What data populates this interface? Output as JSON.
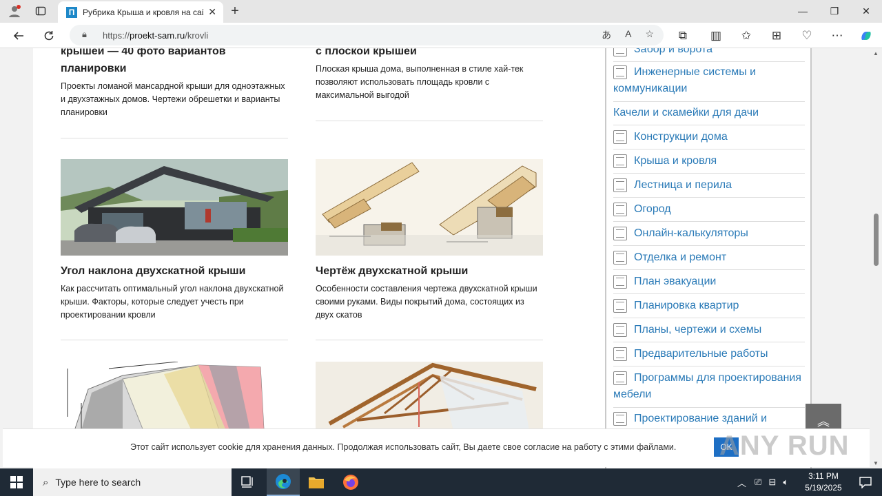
{
  "browser": {
    "tab_title": "Рубрика Крыша и кровля на сайте",
    "tab_favicon": "П",
    "url_prefix": "https://",
    "url_host": "proekt-sam.ru",
    "url_path": "/krovli"
  },
  "articles": [
    {
      "title": "крышей — 40 фото вариантов планировки",
      "desc": "Проекты ломаной мансардной крыши для одноэтажных и двухэтажных домов. Чертежи обрешетки и варианты планировки"
    },
    {
      "title": "с плоской крышей",
      "desc": "Плоская крыша дома, выполненная в стиле хай-тек позволяют использовать площадь кровли с максимальной выгодой"
    },
    {
      "title": "Угол наклона двухскатной крыши",
      "desc": "Как рассчитать оптимальный угол наклона двухскатной крыши. Факторы, которые следует учесть при проектировании кровли"
    },
    {
      "title": "Чертёж двухскатной крыши",
      "desc": "Особенности составления чертежа двухскатной крыши своими руками. Виды покрытий дома, состоящих из двух скатов"
    }
  ],
  "sidebar": {
    "categories": [
      {
        "label": "Забор и ворота",
        "icon": "fence-icon"
      },
      {
        "label": "Инженерные системы и коммуникации",
        "icon": "engineering-icon"
      },
      {
        "label": "Качели и скамейки для дачи",
        "icon": ""
      },
      {
        "label": "Конструкции дома",
        "icon": "house-structure-icon"
      },
      {
        "label": "Крыша и кровля",
        "icon": "roof-icon"
      },
      {
        "label": "Лестница и перила",
        "icon": "stairs-icon"
      },
      {
        "label": "Огород",
        "icon": "garden-icon"
      },
      {
        "label": "Онлайн-калькуляторы",
        "icon": "calculator-icon"
      },
      {
        "label": "Отделка и ремонт",
        "icon": "tools-icon"
      },
      {
        "label": "План эвакуации",
        "icon": "evacuation-icon"
      },
      {
        "label": "Планировка квартир",
        "icon": "floorplan-icon"
      },
      {
        "label": "Планы, чертежи и схемы",
        "icon": "blueprint-icon"
      },
      {
        "label": "Предварительные работы",
        "icon": "preliminary-icon"
      },
      {
        "label": "Программы для проектирования мебели",
        "icon": "code-icon"
      },
      {
        "label": "Проектирование зданий и",
        "icon": "building-icon"
      }
    ]
  },
  "cookie": {
    "text": "Этот сайт использует cookie для хранения данных. Продолжая использовать сайт, Вы даете свое согласие на работу с этими файлами.",
    "ok_label": "OK",
    "watermark": "ANY RUN"
  },
  "taskbar": {
    "search_placeholder": "Type here to search",
    "time": "3:11 PM",
    "date": "5/19/2025"
  },
  "colors": {
    "link": "#2a7ab7",
    "taskbar": "#1f2a36",
    "ok_button": "#1e6fc4"
  }
}
